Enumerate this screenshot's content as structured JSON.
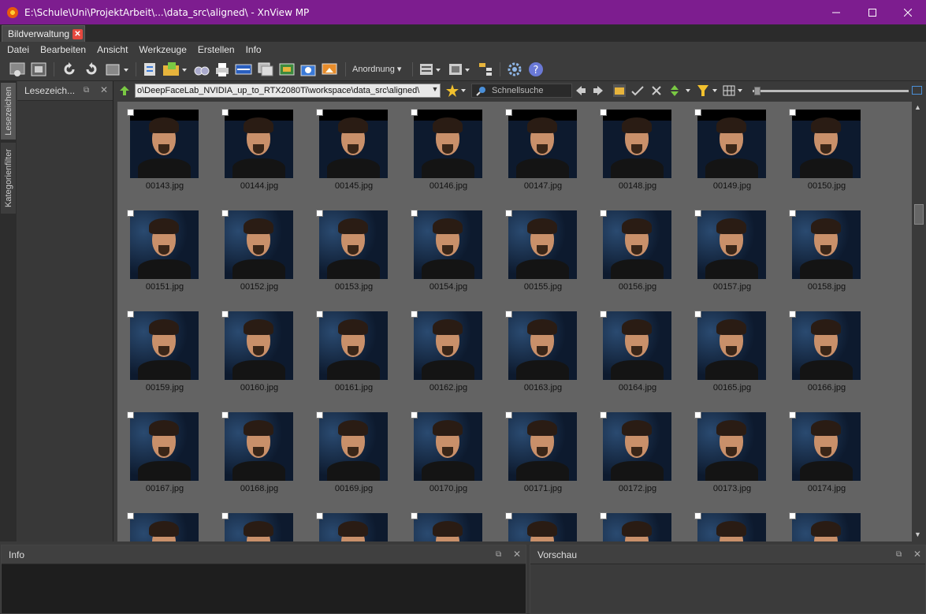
{
  "window": {
    "title": "E:\\Schule\\Uni\\ProjektArbeit\\...\\data_src\\aligned\\ - XnView MP"
  },
  "tabs": [
    {
      "label": "Bildverwaltung"
    }
  ],
  "menu": [
    "Datei",
    "Bearbeiten",
    "Ansicht",
    "Werkzeuge",
    "Erstellen",
    "Info"
  ],
  "toolbar": {
    "arrange_label": "Anordnung"
  },
  "side_tabs": [
    "Lesezeichen",
    "Kategorienfilter"
  ],
  "bookmarks_panel": {
    "title": "Lesezeich..."
  },
  "address": {
    "path": "o\\DeepFaceLab_NVIDIA_up_to_RTX2080Ti\\workspace\\data_src\\aligned\\"
  },
  "search": {
    "placeholder": "Schnellsuche"
  },
  "files": [
    "00143.jpg",
    "00144.jpg",
    "00145.jpg",
    "00146.jpg",
    "00147.jpg",
    "00148.jpg",
    "00149.jpg",
    "00150.jpg",
    "00151.jpg",
    "00152.jpg",
    "00153.jpg",
    "00154.jpg",
    "00155.jpg",
    "00156.jpg",
    "00157.jpg",
    "00158.jpg",
    "00159.jpg",
    "00160.jpg",
    "00161.jpg",
    "00162.jpg",
    "00163.jpg",
    "00164.jpg",
    "00165.jpg",
    "00166.jpg",
    "00167.jpg",
    "00168.jpg",
    "00169.jpg",
    "00170.jpg",
    "00171.jpg",
    "00172.jpg",
    "00173.jpg",
    "00174.jpg",
    "",
    "",
    "",
    "",
    "",
    "",
    "",
    ""
  ],
  "panels": {
    "info_title": "Info",
    "preview_title": "Vorschau"
  },
  "colors": {
    "titlebar": "#7d1d8f",
    "grid_bg": "#636363"
  }
}
